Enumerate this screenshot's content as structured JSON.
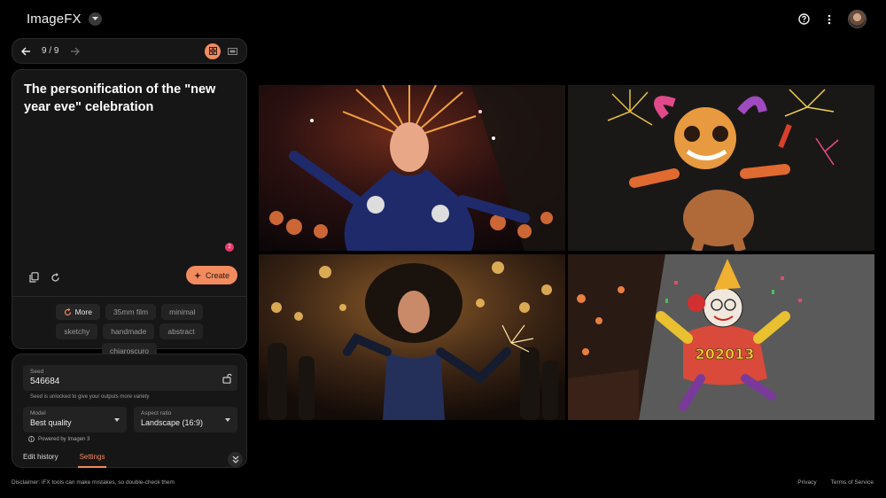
{
  "app": {
    "title": "ImageFX"
  },
  "nav": {
    "counter": "9 / 9"
  },
  "prompt": {
    "text": "The personification of the \"new year eve\" celebration",
    "badge_count": "2",
    "create_label": "Create"
  },
  "chips": [
    {
      "label": "More"
    },
    {
      "label": "35mm film"
    },
    {
      "label": "minimal"
    },
    {
      "label": "sketchy"
    },
    {
      "label": "handmade"
    },
    {
      "label": "abstract"
    },
    {
      "label": "chiaroscuro"
    }
  ],
  "settings": {
    "seed_label": "Seed",
    "seed_value": "546684",
    "seed_note": "Seed is unlocked to give your outputs more variety",
    "model_label": "Model",
    "model_value": "Best quality",
    "aspect_label": "Aspect ratio",
    "aspect_value": "Landscape (16:9)",
    "powered_by": "Powered by Imagen 3",
    "tab_history": "Edit history",
    "tab_settings": "Settings"
  },
  "images": [
    {
      "name": "showgirl-headdress"
    },
    {
      "name": "creature-fireworks"
    },
    {
      "name": "woman-sparklers"
    },
    {
      "name": "clown-sketch",
      "caption": "202013"
    }
  ],
  "footer": {
    "disclaimer": "Disclaimer: iFX tools can make mistakes, so double-check them",
    "privacy": "Privacy",
    "terms": "Terms of Service"
  },
  "colors": {
    "accent": "#f28b5e",
    "badge": "#e8386a",
    "panel": "#161616",
    "background": "#000000"
  }
}
